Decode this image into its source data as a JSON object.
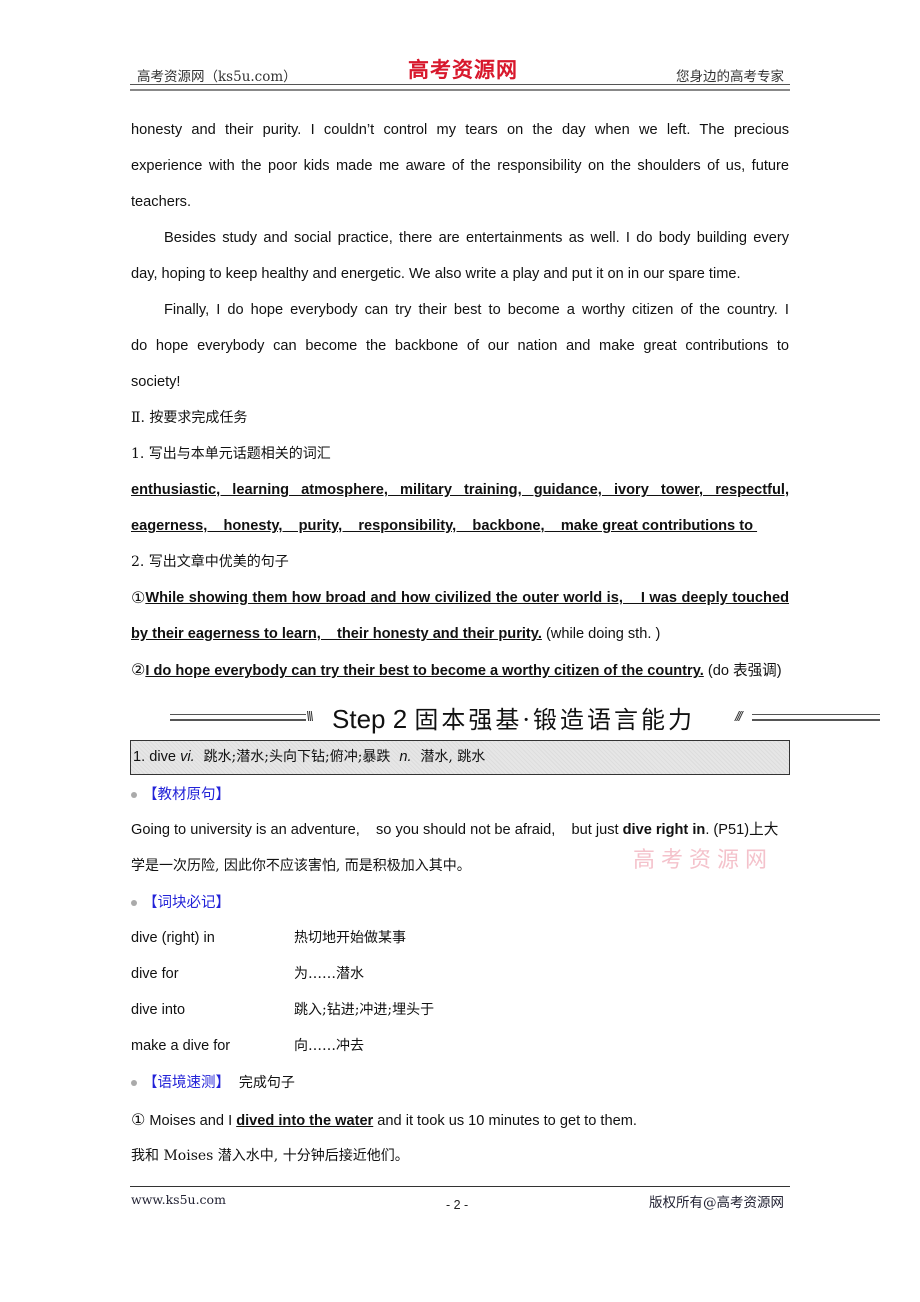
{
  "header": {
    "left": "高考资源网（ks5u.com）",
    "center_logo": "高考资源网",
    "right": "您身边的高考专家"
  },
  "passage": {
    "para1_line1": "honesty and their purity. I couldn’t control my tears on the day when we left. The precious",
    "para1_line2": "experience with the poor kids made me aware of the responsibility on the shoulders of us,    future",
    "para1_line3": "teachers.",
    "para2_line1": "Besides study and social practice,    there are entertainments as well. I do body building every",
    "para2_line2": "day,    hoping to keep healthy and energetic. We also write a play and put it on in our spare time.",
    "para3_line1": "Finally,    I do hope everybody can try their best to become a worthy citizen of the country. I",
    "para3_line2": "do hope everybody can become the backbone of our nation and make great contributions to",
    "para3_line3": "society!"
  },
  "task": {
    "heading": "Ⅱ. 按要求完成任务",
    "q1_label": "1. 写出与本单元话题相关的词汇",
    "vocab_line1": "enthusiastic,    learning atmosphere,    military training,    guidance,    ivory tower,    respectful,",
    "vocab_line2": "eagerness,    honesty,    purity,    responsibility,    backbone,    make great contributions to ",
    "q2_label": "2. 写出文章中优美的句子",
    "sentence1_marker": "①",
    "sentence1_line1": "While showing them how broad and how civilized the outer world is,    I was deeply touched",
    "sentence1_line2": "by their eagerness to learn,    their honesty and their purity.",
    "sentence1_note": " (while doing sth. )",
    "sentence2_marker": "②",
    "sentence2_text": "I do hope everybody can try their best to become a worthy citizen of the country.",
    "sentence2_note": " (do 表强调)"
  },
  "step_banner": {
    "step": "Step 2",
    "title": "固本强基·锻造语言能力",
    "left_deco": "\\\\\\",
    "right_deco": "///"
  },
  "word_entry": {
    "number_word": "1. dive ",
    "pos1": "vi.",
    "meaning1": "  跳水;潜水;头向下钻;俯冲;暴跌  ",
    "pos2": "n.",
    "meaning2": "  潜水, 跳水"
  },
  "textbook_sentence": {
    "label": "【教材原句】",
    "text_before": "Going to university is an adventure,    so you should not be afraid,    but just ",
    "bold": "dive right in",
    "text_after": ". (P51)上大",
    "line2": "学是一次历险, 因此你不应该害怕, 而是积极加入其中。",
    "watermark": "高考资源网"
  },
  "phrases": {
    "label": "【词块必记】",
    "items": [
      {
        "en": "dive (right) in",
        "cn": "热切地开始做某事"
      },
      {
        "en": "dive for",
        "cn": "为……潜水"
      },
      {
        "en": "dive into",
        "cn": "跳入;钻进;冲进;埋头于"
      },
      {
        "en": "make a dive for",
        "cn": "向……冲去"
      }
    ]
  },
  "quiz": {
    "label": "【语境速测】",
    "instruction": "  完成句子",
    "item1_marker": "①",
    "item1_before": " Moises and I ",
    "item1_answer": "dived into the water",
    "item1_after": " and it took us 10 minutes to get to them.",
    "item1_translation": "我和 Moises 潜入水中, 十分钟后接近他们。"
  },
  "footer": {
    "left": "www.ks5u.com",
    "page": "- 2 -",
    "right": "版权所有@高考资源网"
  }
}
